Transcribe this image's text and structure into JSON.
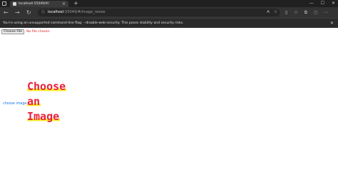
{
  "browser": {
    "tab_title": "localhost:55049/#/",
    "tab_close": "×",
    "new_tab": "+",
    "window_controls": [
      "—",
      "☐",
      "✕"
    ],
    "address": {
      "host": "localhost",
      "path": ":55049/#/image_resize"
    }
  },
  "warning": {
    "text": "You're using an unsupported command-line flag: --disable-web-security. This poses stability and security risks.",
    "close": "✕"
  },
  "page": {
    "file_button_label": "Choose File",
    "file_status": "No file chosen",
    "choose_link": "choose image",
    "heading": [
      "Choose",
      "an",
      "Image"
    ]
  },
  "colors": {
    "heading": "#e8213a",
    "highlight": "#f7ef2e",
    "link": "#1a73e8",
    "file_status": "#e02020"
  }
}
